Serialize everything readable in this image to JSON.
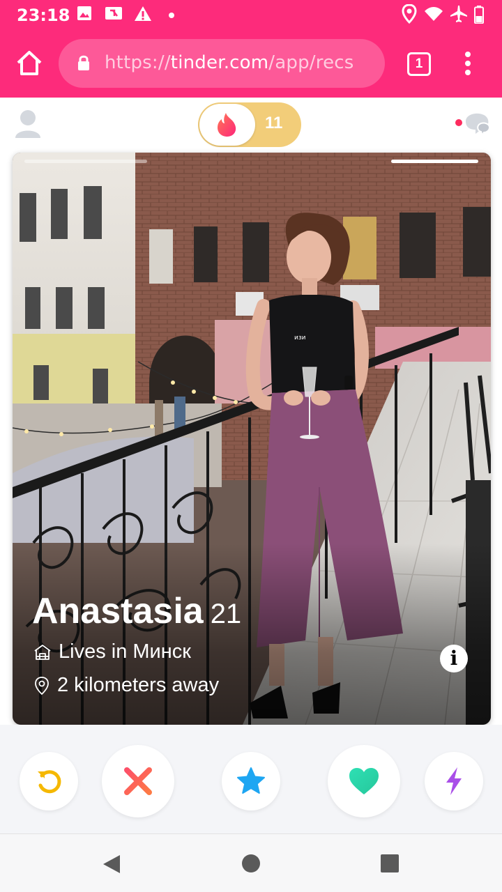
{
  "status_bar": {
    "time": "23:18",
    "icons": [
      "image-icon",
      "nfc-icon",
      "warning-icon",
      "dot-icon",
      "location-icon",
      "wifi-icon",
      "airplane-icon",
      "battery-icon"
    ]
  },
  "browser": {
    "url_scheme": "https://",
    "url_host": "tinder.com",
    "url_path": "/app/recs",
    "tab_count": "1"
  },
  "header": {
    "boost_count": "11"
  },
  "profile": {
    "name": "Anastasia",
    "age": "21",
    "lives_in": "Lives in Минск",
    "distance": "2 kilometers away",
    "photo_index": 2,
    "photo_count": 2
  },
  "actions": [
    "rewind-button",
    "nope-button",
    "super-like-button",
    "like-button",
    "boost-button"
  ],
  "colors": {
    "brand": "#fd2b7b",
    "rewind": "#f5b800",
    "nope": "#fd4f6a",
    "super_like": "#1ea6f2",
    "like": "#2cd8a6",
    "boost": "#a94ee8"
  }
}
